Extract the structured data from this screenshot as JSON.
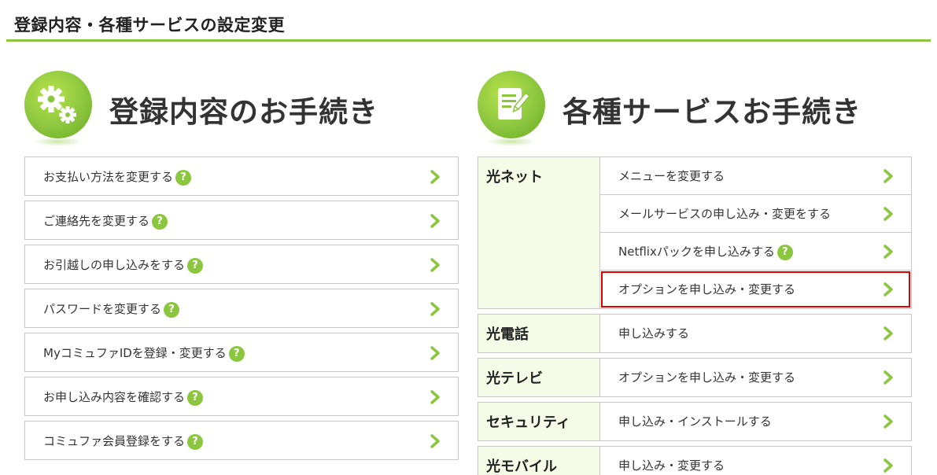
{
  "page_title": "登録内容・各種サービスの設定変更",
  "colors": {
    "accent": "#8cc63f",
    "highlight": "#e00000",
    "category_bg": "#f4fbe6"
  },
  "left_section": {
    "title": "登録内容のお手続き",
    "icon": "gears-icon",
    "items": [
      {
        "label": "お支払い方法を変更する",
        "help": true
      },
      {
        "label": "ご連絡先を変更する",
        "help": true
      },
      {
        "label": "お引越しの申し込みをする",
        "help": true
      },
      {
        "label": "パスワードを変更する",
        "help": true
      },
      {
        "label": "MyコミュファIDを登録・変更する",
        "help": true
      },
      {
        "label": "お申し込み内容を確認する",
        "help": true
      },
      {
        "label": "コミュファ会員登録をする",
        "help": true
      }
    ]
  },
  "right_section": {
    "title": "各種サービスお手続き",
    "icon": "document-edit-icon",
    "groups": [
      {
        "category": "光ネット",
        "rows": [
          {
            "label": "メニューを変更する",
            "help": false
          },
          {
            "label": "メールサービスの申し込み・変更をする",
            "help": false
          },
          {
            "label": "Netflixパックを申し込みする",
            "help": true
          },
          {
            "label": "オプションを申し込み・変更する",
            "help": false,
            "highlighted": true
          }
        ]
      },
      {
        "category": "光電話",
        "rows": [
          {
            "label": "申し込みする",
            "help": false
          }
        ]
      },
      {
        "category": "光テレビ",
        "rows": [
          {
            "label": "オプションを申し込み・変更する",
            "help": false
          }
        ]
      },
      {
        "category": "セキュリティ",
        "rows": [
          {
            "label": "申し込み・インストールする",
            "help": false
          }
        ]
      },
      {
        "category": "光モバイル",
        "rows": [
          {
            "label": "申し込み・変更する",
            "help": false
          }
        ]
      }
    ]
  },
  "help_glyph": "?"
}
